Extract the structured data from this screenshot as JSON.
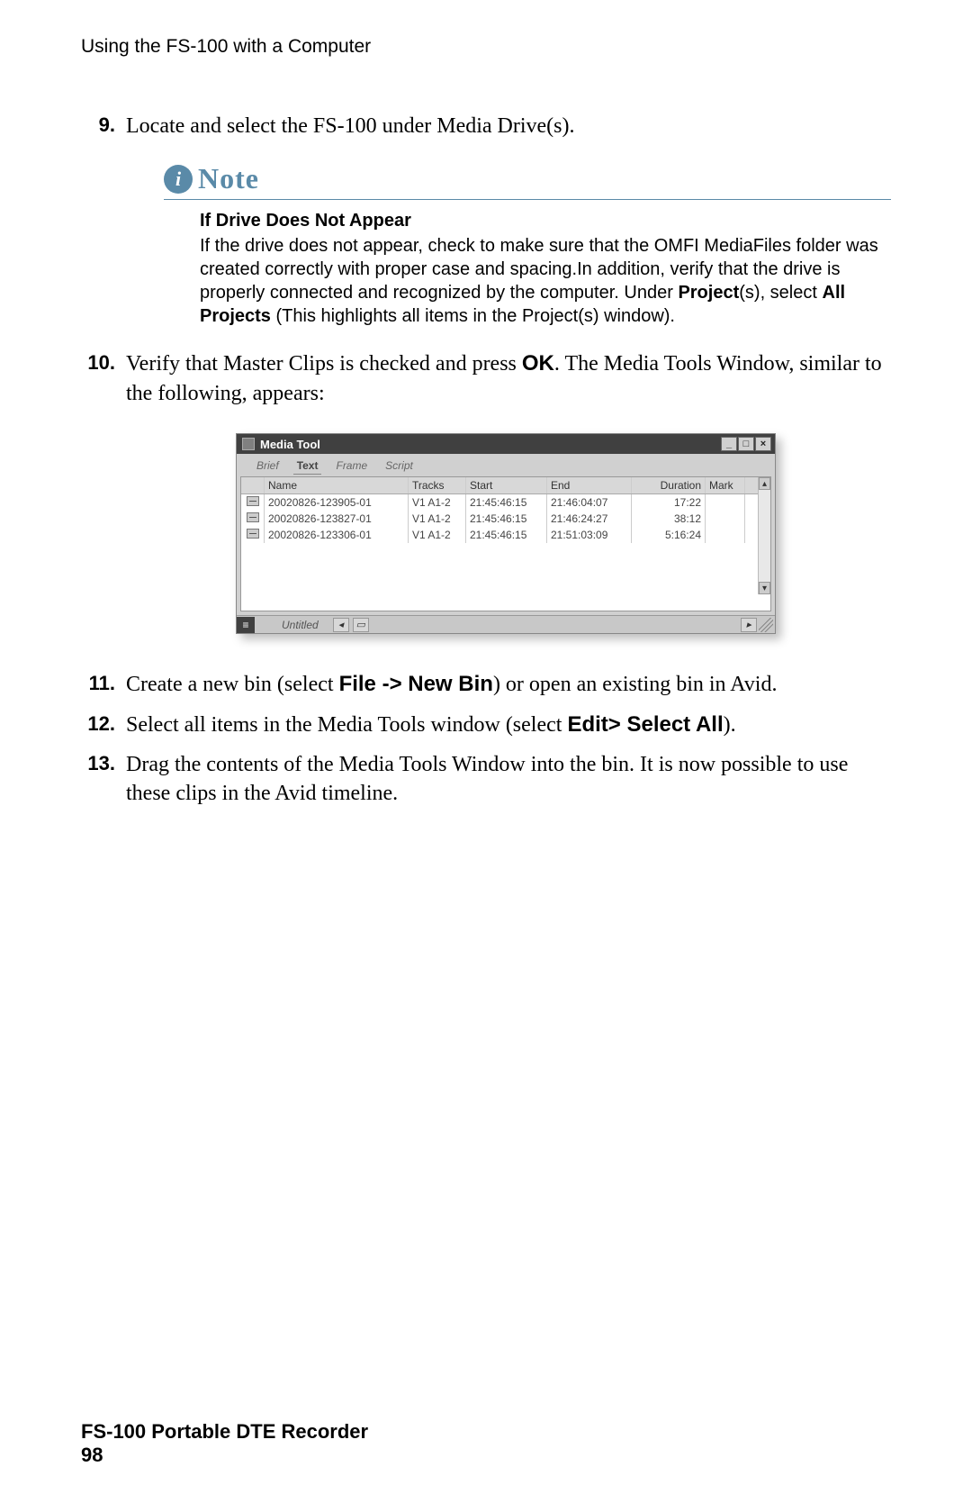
{
  "header": "Using the FS-100 with a Computer",
  "steps": {
    "s9": {
      "num": "9.",
      "text": "Locate and select the FS-100 under Media Drive(s)."
    },
    "s10": {
      "num": "10.",
      "pre": "Verify that Master Clips is checked and press ",
      "bold": "OK",
      "post": ". The Media Tools Window, similar to the following, appears:"
    },
    "s11": {
      "num": "11.",
      "pre": "Create a new bin (select ",
      "b1": "File -> New Bin",
      "post": ") or open an existing bin in Avid."
    },
    "s12": {
      "num": "12.",
      "pre": "Select all items in the Media Tools window (select ",
      "b1": "Edit> Select All",
      "post": ")."
    },
    "s13": {
      "num": "13.",
      "text": "Drag the contents of the Media Tools Window into the bin. It is now possible to use these clips in the Avid timeline."
    }
  },
  "note": {
    "label": "Note",
    "title": "If Drive Does Not Appear",
    "body_pre": "If the drive does not appear, check to make sure that the OMFI MediaFiles folder was created correctly with proper case and spacing.In addition, verify that the drive is properly connected and recognized by the computer. Under ",
    "b1": "Project",
    "mid1": "(s), select ",
    "b2": "All Projects",
    "body_post": " (This highlights all items in the Project(s) window)."
  },
  "media_tool": {
    "title": "Media Tool",
    "tabs": [
      "Brief",
      "Text",
      "Frame",
      "Script"
    ],
    "columns": {
      "name": "Name",
      "tracks": "Tracks",
      "start": "Start",
      "end": "End",
      "duration": "Duration",
      "mark": "Mark"
    },
    "rows": [
      {
        "name": "20020826-123905-01",
        "tracks": "V1 A1-2",
        "start": "21:45:46:15",
        "end": "21:46:04:07",
        "duration": "17:22"
      },
      {
        "name": "20020826-123827-01",
        "tracks": "V1 A1-2",
        "start": "21:45:46:15",
        "end": "21:46:24:27",
        "duration": "38:12"
      },
      {
        "name": "20020826-123306-01",
        "tracks": "V1 A1-2",
        "start": "21:45:46:15",
        "end": "21:51:03:09",
        "duration": "5:16:24"
      }
    ],
    "status": "Untitled"
  },
  "footer": {
    "title": "FS-100 Portable DTE Recorder",
    "page": "98"
  }
}
